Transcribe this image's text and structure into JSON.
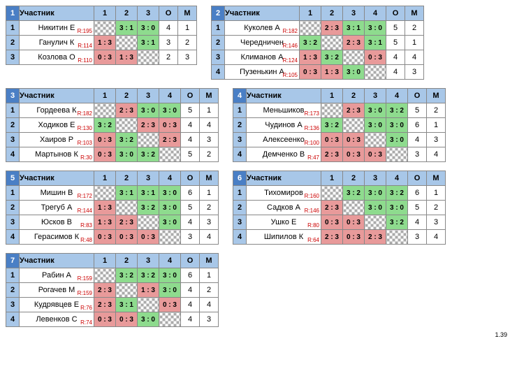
{
  "labels": {
    "participant": "Участник",
    "points": "О",
    "place": "М"
  },
  "footer": "1.39",
  "groups": [
    {
      "num": "1",
      "size": 3,
      "players": [
        {
          "name": "Никитин Е",
          "rating": "R:195",
          "o": "4",
          "m": "1",
          "cells": [
            null,
            "3 : 1",
            "3 : 0"
          ]
        },
        {
          "name": "Ганулич К",
          "rating": "R:114",
          "o": "3",
          "m": "2",
          "cells": [
            "1 : 3",
            null,
            "3 : 1"
          ]
        },
        {
          "name": "Козлова О",
          "rating": "R:110",
          "o": "2",
          "m": "3",
          "cells": [
            "0 : 3",
            "1 : 3",
            null
          ]
        }
      ]
    },
    {
      "num": "2",
      "size": 4,
      "players": [
        {
          "name": "Куколев А",
          "rating": "R:182",
          "o": "5",
          "m": "2",
          "cells": [
            null,
            "2 : 3",
            "3 : 1",
            "3 : 0"
          ]
        },
        {
          "name": "Чередничен",
          "rating": "R:146",
          "o": "5",
          "m": "1",
          "cells": [
            "3 : 2",
            null,
            "2 : 3",
            "3 : 1"
          ]
        },
        {
          "name": "Климанов А",
          "rating": "R:124",
          "o": "4",
          "m": "4",
          "cells": [
            "1 : 3",
            "3 : 2",
            null,
            "0 : 3"
          ]
        },
        {
          "name": "Пузенькин А",
          "rating": "R:105",
          "o": "4",
          "m": "3",
          "cells": [
            "0 : 3",
            "1 : 3",
            "3 : 0",
            null
          ]
        }
      ]
    },
    {
      "num": "3",
      "size": 4,
      "players": [
        {
          "name": "Гордеева К",
          "rating": "R:182",
          "o": "5",
          "m": "1",
          "cells": [
            null,
            "2 : 3",
            "3 : 0",
            "3 : 0"
          ]
        },
        {
          "name": "Ходиков Е",
          "rating": "R:130",
          "o": "4",
          "m": "4",
          "cells": [
            "3 : 2",
            null,
            "2 : 3",
            "0 : 3"
          ]
        },
        {
          "name": "Хаиров Р",
          "rating": "R:103",
          "o": "4",
          "m": "3",
          "cells": [
            "0 : 3",
            "3 : 2",
            null,
            "2 : 3"
          ]
        },
        {
          "name": "Мартынов К",
          "rating": "R:30",
          "o": "5",
          "m": "2",
          "cells": [
            "0 : 3",
            "3 : 0",
            "3 : 2",
            null
          ]
        }
      ]
    },
    {
      "num": "4",
      "size": 4,
      "players": [
        {
          "name": "Меньшиков",
          "rating": "R:173",
          "o": "5",
          "m": "2",
          "cells": [
            null,
            "2 : 3",
            "3 : 0",
            "3 : 2"
          ]
        },
        {
          "name": "Чудинов А",
          "rating": "R:136",
          "o": "6",
          "m": "1",
          "cells": [
            "3 : 2",
            null,
            "3 : 0",
            "3 : 0"
          ]
        },
        {
          "name": "Алексеенко",
          "rating": "R:100",
          "o": "4",
          "m": "3",
          "cells": [
            "0 : 3",
            "0 : 3",
            null,
            "3 : 0"
          ]
        },
        {
          "name": "Демченко В",
          "rating": "R:47",
          "o": "3",
          "m": "4",
          "cells": [
            "2 : 3",
            "0 : 3",
            "0 : 3",
            null
          ]
        }
      ]
    },
    {
      "num": "5",
      "size": 4,
      "players": [
        {
          "name": "Мишин В",
          "rating": "R:172",
          "o": "6",
          "m": "1",
          "cells": [
            null,
            "3 : 1",
            "3 : 1",
            "3 : 0"
          ]
        },
        {
          "name": "Трегуб А",
          "rating": "R:144",
          "o": "5",
          "m": "2",
          "cells": [
            "1 : 3",
            null,
            "3 : 2",
            "3 : 0"
          ]
        },
        {
          "name": "Юсков В",
          "rating": "R:83",
          "o": "4",
          "m": "3",
          "cells": [
            "1 : 3",
            "2 : 3",
            null,
            "3 : 0"
          ]
        },
        {
          "name": "Герасимов К",
          "rating": "R:48",
          "o": "3",
          "m": "4",
          "cells": [
            "0 : 3",
            "0 : 3",
            "0 : 3",
            null
          ]
        }
      ]
    },
    {
      "num": "6",
      "size": 4,
      "players": [
        {
          "name": "Тихомиров",
          "rating": "R:160",
          "o": "6",
          "m": "1",
          "cells": [
            null,
            "3 : 2",
            "3 : 0",
            "3 : 2"
          ]
        },
        {
          "name": "Садков А",
          "rating": "R:146",
          "o": "5",
          "m": "2",
          "cells": [
            "2 : 3",
            null,
            "3 : 0",
            "3 : 0"
          ]
        },
        {
          "name": "Ушко Е",
          "rating": "R:80",
          "o": "4",
          "m": "3",
          "cells": [
            "0 : 3",
            "0 : 3",
            null,
            "3 : 2"
          ]
        },
        {
          "name": "Шипилов К",
          "rating": "R:64",
          "o": "3",
          "m": "4",
          "cells": [
            "2 : 3",
            "0 : 3",
            "2 : 3",
            null
          ]
        }
      ]
    },
    {
      "num": "7",
      "size": 4,
      "players": [
        {
          "name": "Рабин А",
          "rating": "R:159",
          "o": "6",
          "m": "1",
          "cells": [
            null,
            "3 : 2",
            "3 : 2",
            "3 : 0"
          ]
        },
        {
          "name": "Рогачев М",
          "rating": "R:159",
          "o": "4",
          "m": "2",
          "cells": [
            "2 : 3",
            null,
            "1 : 3",
            "3 : 0"
          ]
        },
        {
          "name": "Кудрявцев Е",
          "rating": "R:76",
          "o": "4",
          "m": "4",
          "cells": [
            "2 : 3",
            "3 : 1",
            null,
            "0 : 3"
          ]
        },
        {
          "name": "Левенков С",
          "rating": "R:74",
          "o": "4",
          "m": "3",
          "cells": [
            "0 : 3",
            "0 : 3",
            "3 : 0",
            null
          ]
        }
      ]
    }
  ]
}
